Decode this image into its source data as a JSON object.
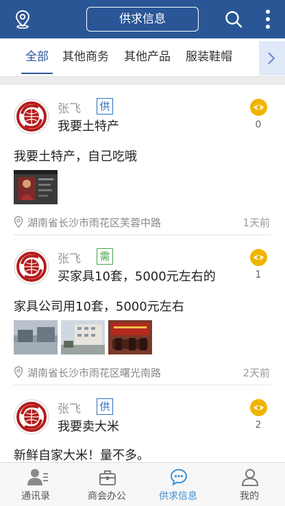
{
  "header": {
    "title": "供求信息",
    "icons": {
      "left": "location-pin-icon",
      "search": "search-icon",
      "more": "more-vertical-icon"
    },
    "bg_color": "#2a5696"
  },
  "tabs": {
    "items": [
      {
        "label": "全部",
        "active": true
      },
      {
        "label": "其他商务",
        "active": false
      },
      {
        "label": "其他产品",
        "active": false
      },
      {
        "label": "服装鞋帽",
        "active": false
      }
    ],
    "scroll_icon": "chevron-right-icon"
  },
  "posts": [
    {
      "author": "张飞",
      "type": "供",
      "title": "我要土特产",
      "views": "0",
      "body": "我要土特产，自己吃哦",
      "address": "湖南省长沙市雨花区芙蓉中路",
      "time": "1天前"
    },
    {
      "author": "张飞",
      "type": "需",
      "title": "买家具10套，5000元左右的",
      "views": "1",
      "body": "家具公司用10套，5000元左右",
      "address": "湖南省长沙市雨花区曙光南路",
      "time": "2天前"
    },
    {
      "author": "张飞",
      "type": "供",
      "title": "我要卖大米",
      "views": "2",
      "body": "新鲜自家大米！量不多。"
    }
  ],
  "bottom_nav": [
    {
      "label": "通讯录",
      "icon": "contacts-icon",
      "active": false
    },
    {
      "label": "商会办公",
      "icon": "briefcase-icon",
      "active": false
    },
    {
      "label": "供求信息",
      "icon": "chat-bubble-icon",
      "active": true
    },
    {
      "label": "我的",
      "icon": "user-icon",
      "active": false
    }
  ],
  "colors": {
    "accent": "#2a5696",
    "eye_badge": "#f0b400",
    "active_nav": "#3b8fd6",
    "supply_badge": "#2a6ec0",
    "demand_badge": "#4aa34a"
  }
}
